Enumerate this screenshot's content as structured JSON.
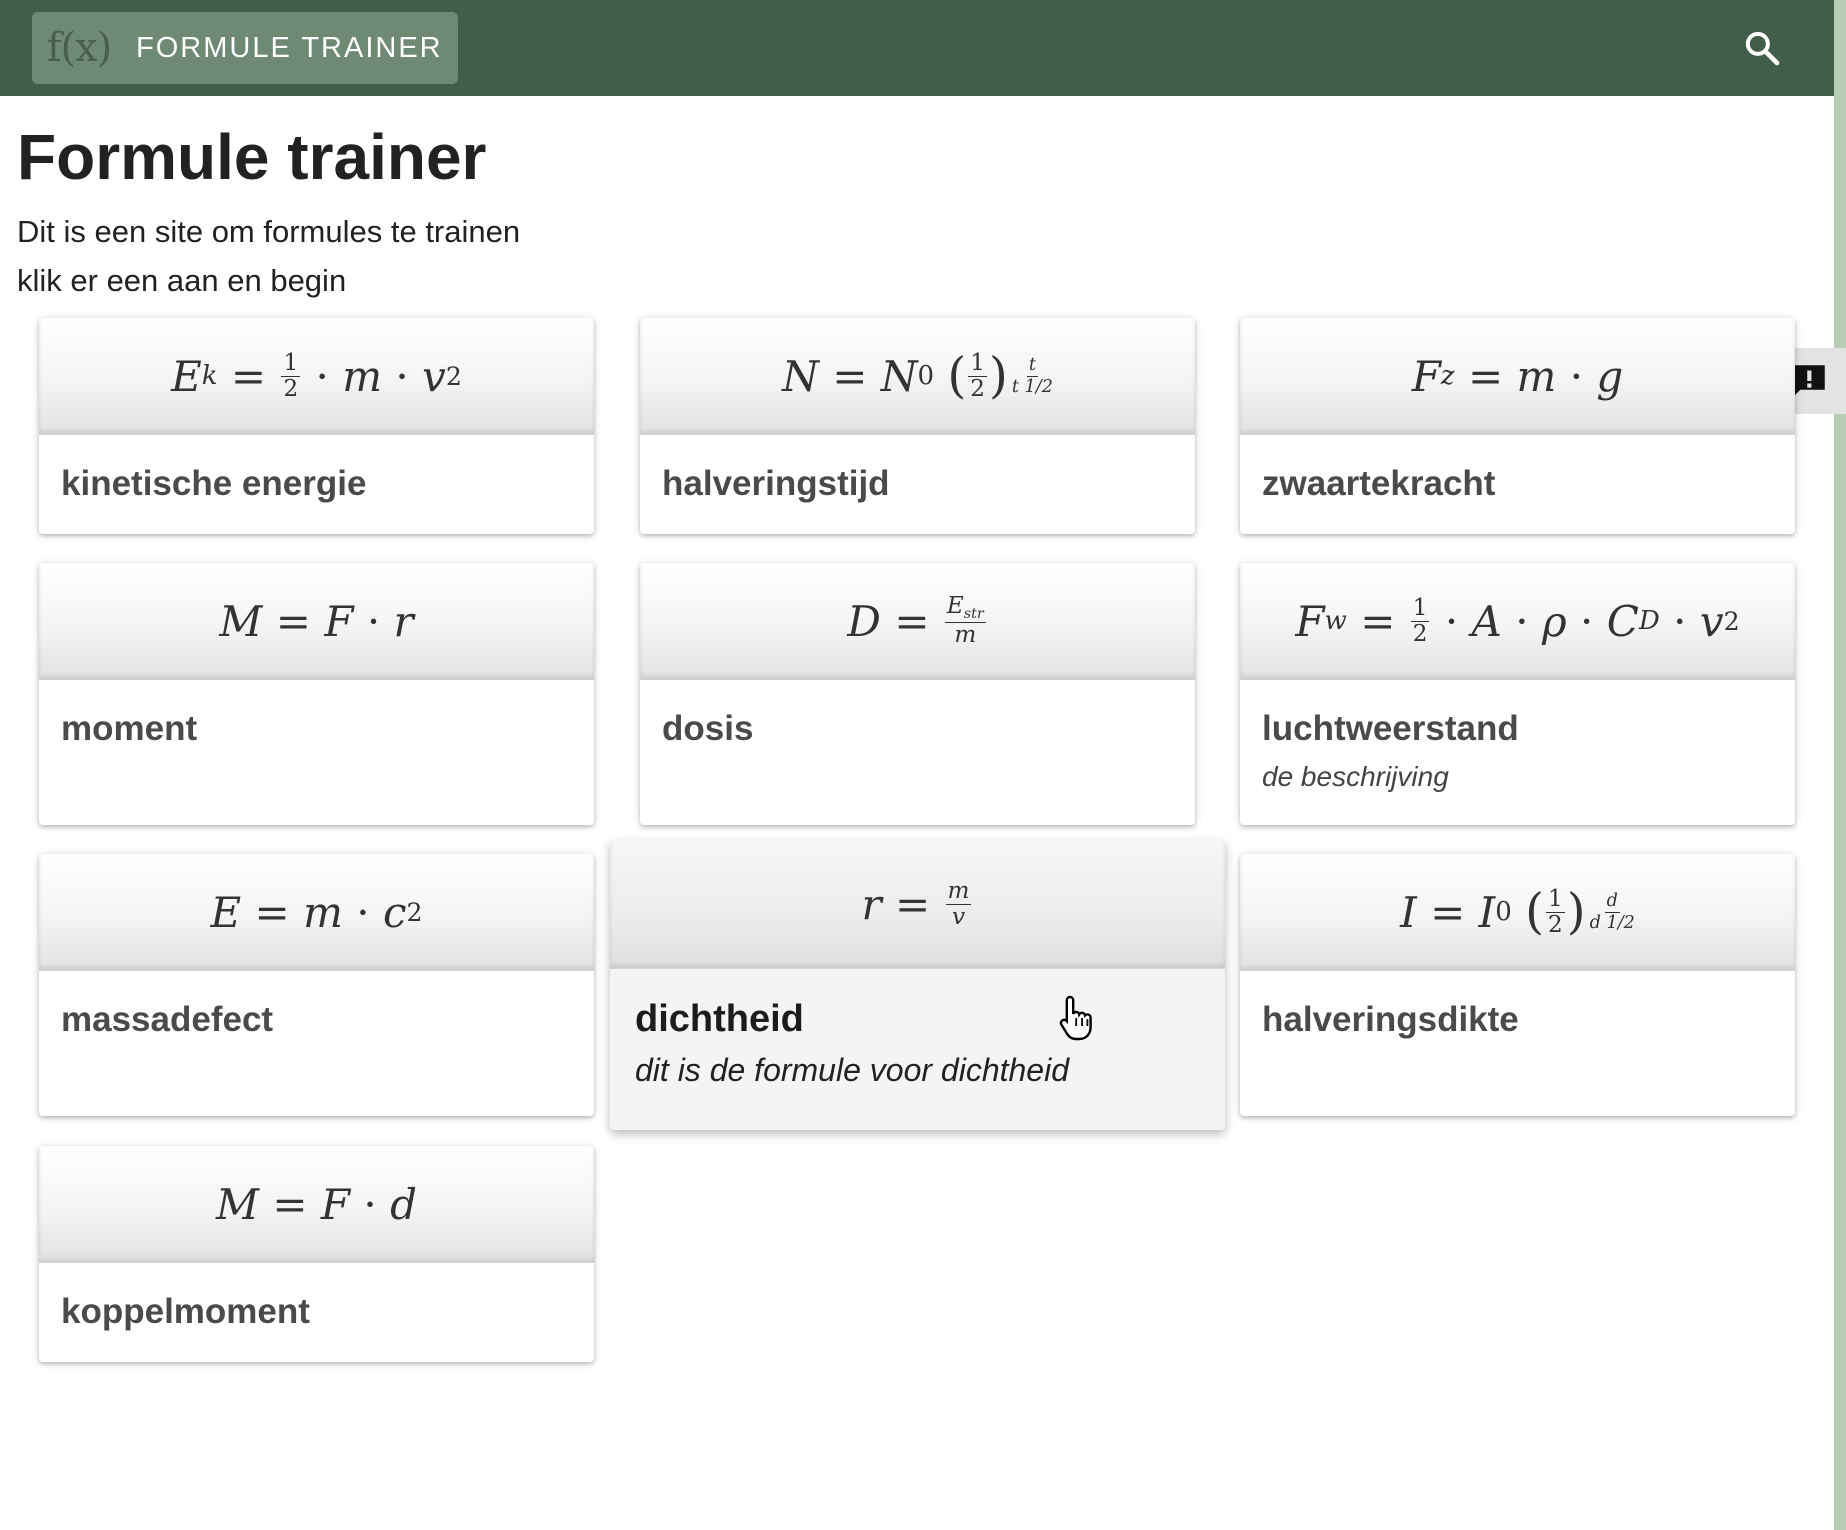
{
  "appbar": {
    "logo_text": "f(x)",
    "title": "FORMULE TRAINER",
    "search_icon": "search-icon",
    "background": "#415e4a"
  },
  "page": {
    "title": "Formule trainer",
    "intro_line1": "Dit is een site om formules te trainen",
    "intro_line2": "klik er een aan en begin"
  },
  "feedback": {
    "icon": "feedback-exclamation-icon"
  },
  "cards": [
    {
      "name": "kinetische energie",
      "formula": "E_k = 1/2 · m · v^2",
      "description": ""
    },
    {
      "name": "halveringstijd",
      "formula": "N = N_0 (1/2)^(t / t_1/2)",
      "description": ""
    },
    {
      "name": "zwaartekracht",
      "formula": "F_z = m · g",
      "description": ""
    },
    {
      "name": "moment",
      "formula": "M = F · r",
      "description": ""
    },
    {
      "name": "dosis",
      "formula": "D = E_str / m",
      "description": ""
    },
    {
      "name": "luchtweerstand",
      "formula": "F_w = 1/2 · A · ρ · C_D · v^2",
      "description": "de beschrijving"
    },
    {
      "name": "massadefect",
      "formula": "E = m · c^2",
      "description": ""
    },
    {
      "name": "dichtheid",
      "formula": "r = m / v",
      "description": "dit is de formule voor dichtheid"
    },
    {
      "name": "halveringsdikte",
      "formula": "I = I_0 (1/2)^(d / d_1/2)",
      "description": ""
    },
    {
      "name": "koppelmoment",
      "formula": "M = F · d",
      "description": ""
    }
  ],
  "formula_parts": {
    "ek": {
      "E": "E",
      "k": "k",
      "eq": "=",
      "n": "1",
      "d": "2",
      "dot": "·",
      "m": "m",
      "v": "v",
      "p": "2"
    },
    "half": {
      "N": "N",
      "eq": "=",
      "N0": "N",
      "zero": "0",
      "lp": "(",
      "n": "1",
      "d": "2",
      "rp": ")",
      "t": "t",
      "tden": "t",
      "hn": "1",
      "hd": "2"
    },
    "fz": {
      "F": "F",
      "z": "z",
      "eq": "=",
      "m": "m",
      "dot": "·",
      "g": "g"
    },
    "mom": {
      "M": "M",
      "eq": "=",
      "F": "F",
      "dot": "·",
      "r": "r"
    },
    "dos": {
      "D": "D",
      "eq": "=",
      "E": "E",
      "str": "str",
      "m": "m"
    },
    "fw": {
      "F": "F",
      "w": "w",
      "eq": "=",
      "n": "1",
      "d": "2",
      "dot": "·",
      "A": "A",
      "rho": "ρ",
      "C": "C",
      "D": "D",
      "v": "v",
      "p": "2"
    },
    "emc": {
      "E": "E",
      "eq": "=",
      "m": "m",
      "dot": "·",
      "c": "c",
      "p": "2"
    },
    "rho": {
      "r": "r",
      "eq": "=",
      "m": "m",
      "v": "v"
    },
    "hd": {
      "I": "I",
      "eq": "=",
      "I0": "I",
      "zero": "0",
      "lp": "(",
      "n": "1",
      "d": "2",
      "rp": ")",
      "dn": "d",
      "dd": "d",
      "hn": "1",
      "hdd": "2"
    },
    "kop": {
      "M": "M",
      "eq": "=",
      "F": "F",
      "dot": "·",
      "d": "d"
    }
  }
}
